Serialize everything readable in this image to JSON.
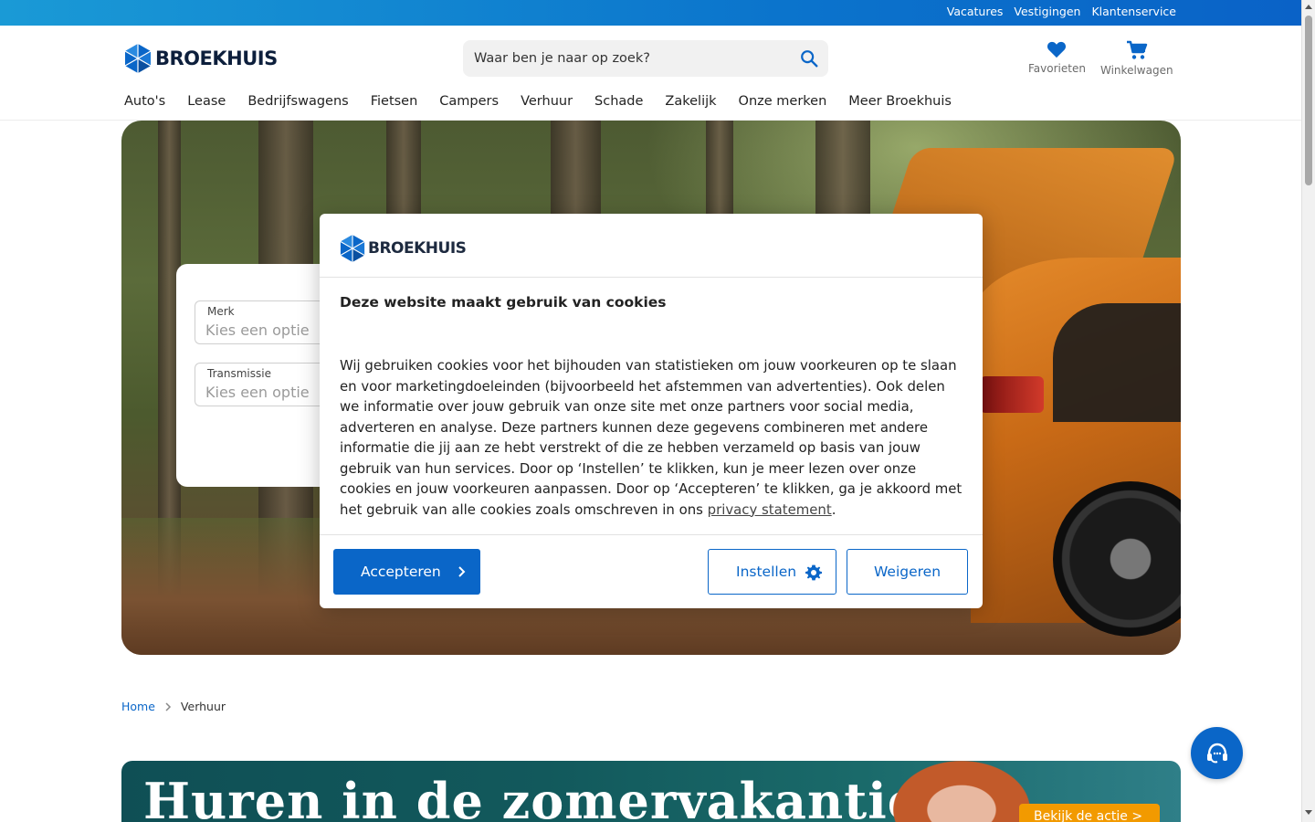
{
  "topbar": {
    "links": [
      "Vacatures",
      "Vestigingen",
      "Klantenservice"
    ]
  },
  "header": {
    "brand": "BROEKHUIS",
    "search_placeholder": "Waar ben je naar op zoek?",
    "favorites_label": "Favorieten",
    "cart_label": "Winkelwagen",
    "nav": [
      "Auto's",
      "Lease",
      "Bedrijfswagens",
      "Fietsen",
      "Campers",
      "Verhuur",
      "Schade",
      "Zakelijk",
      "Onze merken",
      "Meer Broekhuis"
    ]
  },
  "filter": {
    "fields": [
      {
        "label": "Merk",
        "value": "Kies een optie"
      },
      {
        "label": "Transmissie",
        "value": "Kies een optie"
      }
    ]
  },
  "cookie_modal": {
    "brand": "BROEKHUIS",
    "title": "Deze website maakt gebruik van cookies",
    "body": "Wij gebruiken cookies voor het bijhouden van statistieken om jouw voorkeuren op te slaan en voor marketingdoeleinden (bijvoorbeeld het afstemmen van advertenties). Ook delen we informatie over jouw gebruik van onze site met onze partners voor social media, adverteren en analyse. Deze partners kunnen deze gegevens combineren met andere informatie die jij aan ze hebt verstrekt of die ze hebben verzameld op basis van jouw gebruik van hun services. Door op ‘Instellen’ te klikken, kun je meer lezen over onze cookies en jouw voorkeuren aanpassen. Door op ‘Accepteren’ te klikken, ga je akkoord met het gebruik van alle cookies zoals omschreven in ons ",
    "privacy_link": "privacy statement",
    "body_end": ".",
    "accept_label": "Accepteren",
    "settings_label": "Instellen",
    "refuse_label": "Weigeren"
  },
  "breadcrumb": {
    "home": "Home",
    "current": "Verhuur"
  },
  "promo": {
    "title": "Huren in de zomervakantie?",
    "button": "Bekijk de actie >"
  },
  "colors": {
    "brand_blue": "#0a66c8",
    "promo_orange": "#f29a00"
  }
}
